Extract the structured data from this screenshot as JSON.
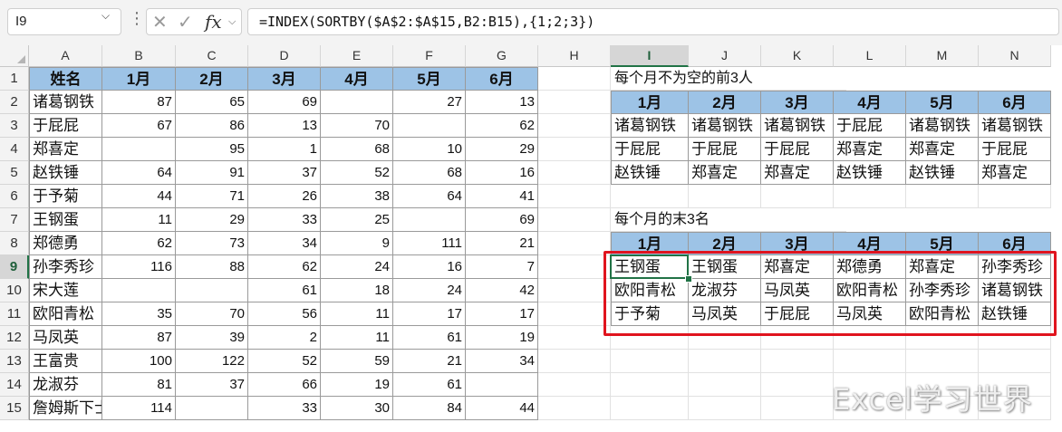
{
  "formula_bar": {
    "name_box": "I9",
    "cancel_icon": "✕",
    "enter_icon": "✓",
    "fx_label": "fx",
    "formula": "=INDEX(SORTBY($A$2:$A$15,B2:B15),{1;2;3})"
  },
  "columns": [
    "A",
    "B",
    "C",
    "D",
    "E",
    "F",
    "G",
    "H",
    "I",
    "J",
    "K",
    "L",
    "M",
    "N"
  ],
  "rows": [
    "1",
    "2",
    "3",
    "4",
    "5",
    "6",
    "7",
    "8",
    "9",
    "10",
    "11",
    "12",
    "13",
    "14",
    "15"
  ],
  "active_cell": {
    "col": "I",
    "row": "9"
  },
  "main_table": {
    "headers": [
      "姓名",
      "1月",
      "2月",
      "3月",
      "4月",
      "5月",
      "6月"
    ],
    "rows": [
      [
        "诸葛钢铁",
        "87",
        "65",
        "69",
        "",
        "27",
        "13"
      ],
      [
        "于屁屁",
        "67",
        "86",
        "13",
        "70",
        "",
        "62"
      ],
      [
        "郑喜定",
        "",
        "95",
        "1",
        "68",
        "10",
        "29"
      ],
      [
        "赵铁锤",
        "64",
        "91",
        "37",
        "52",
        "68",
        "16"
      ],
      [
        "于予菊",
        "44",
        "71",
        "26",
        "38",
        "64",
        "41"
      ],
      [
        "王钢蛋",
        "11",
        "29",
        "33",
        "25",
        "",
        "69"
      ],
      [
        "郑德勇",
        "62",
        "73",
        "34",
        "9",
        "111",
        "21"
      ],
      [
        "孙李秀珍",
        "116",
        "88",
        "62",
        "24",
        "16",
        "7"
      ],
      [
        "宋大莲",
        "",
        "",
        "61",
        "18",
        "24",
        "42"
      ],
      [
        "欧阳青松",
        "35",
        "70",
        "56",
        "11",
        "17",
        "17"
      ],
      [
        "马凤英",
        "87",
        "39",
        "2",
        "11",
        "61",
        "19"
      ],
      [
        "王富贵",
        "100",
        "122",
        "52",
        "59",
        "21",
        "34"
      ],
      [
        "龙淑芬",
        "81",
        "37",
        "66",
        "19",
        "61",
        ""
      ],
      [
        "詹姆斯下士",
        "114",
        "",
        "33",
        "30",
        "84",
        "44"
      ]
    ]
  },
  "top3": {
    "title": "每个月不为空的前3人",
    "headers": [
      "1月",
      "2月",
      "3月",
      "4月",
      "5月",
      "6月"
    ],
    "rows": [
      [
        "诸葛钢铁",
        "诸葛钢铁",
        "诸葛钢铁",
        "于屁屁",
        "诸葛钢铁",
        "诸葛钢铁"
      ],
      [
        "于屁屁",
        "于屁屁",
        "于屁屁",
        "郑喜定",
        "郑喜定",
        "于屁屁"
      ],
      [
        "赵铁锤",
        "郑喜定",
        "郑喜定",
        "赵铁锤",
        "赵铁锤",
        "郑喜定"
      ]
    ]
  },
  "bottom3": {
    "title": "每个月的末3名",
    "headers": [
      "1月",
      "2月",
      "3月",
      "4月",
      "5月",
      "6月"
    ],
    "rows": [
      [
        "王钢蛋",
        "王钢蛋",
        "郑喜定",
        "郑德勇",
        "郑喜定",
        "孙李秀珍"
      ],
      [
        "欧阳青松",
        "龙淑芬",
        "马凤英",
        "欧阳青松",
        "孙李秀珍",
        "诸葛钢铁"
      ],
      [
        "于予菊",
        "马凤英",
        "于屁屁",
        "马凤英",
        "欧阳青松",
        "赵铁锤"
      ]
    ]
  },
  "watermark": "Excel学习世界",
  "colors": {
    "header_fill": "#9dc3e6",
    "highlight_box": "#e0141e",
    "selection": "#217346"
  }
}
